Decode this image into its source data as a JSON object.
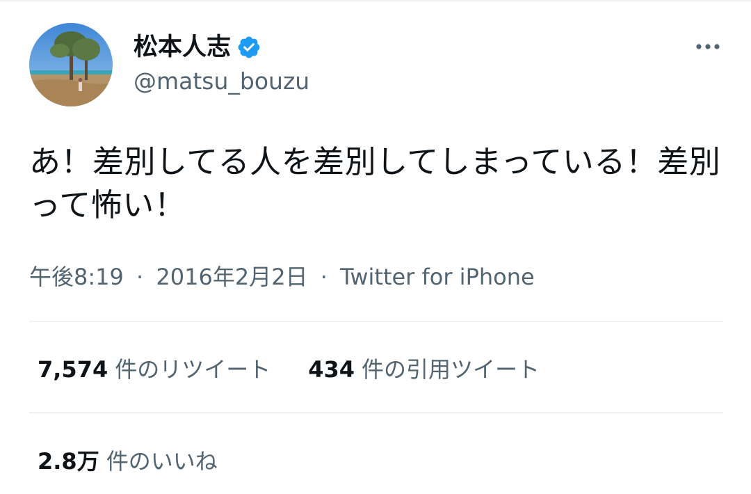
{
  "user": {
    "display_name": "松本人志",
    "handle": "@matsu_bouzu",
    "verified": true,
    "avatar_icon": "avatar-photo-beach-tree"
  },
  "header": {
    "more_icon": "more-horizontal-icon"
  },
  "tweet": {
    "text": "あ！差別してる人を差別してしまっている！差別って怖い！"
  },
  "meta": {
    "time": "午後8:19",
    "separator": "·",
    "date": "2016年2月2日",
    "source": "Twitter for iPhone"
  },
  "stats": {
    "retweets": {
      "count": "7,574",
      "label": "件のリツイート"
    },
    "quote_tweets": {
      "count": "434",
      "label": "件の引用ツイート"
    },
    "likes": {
      "count": "2.8万",
      "label": "件のいいね"
    }
  },
  "colors": {
    "text_primary": "#0f1419",
    "text_secondary": "#536471",
    "divider": "#eff3f4",
    "verified_blue": "#1d9bf0"
  }
}
